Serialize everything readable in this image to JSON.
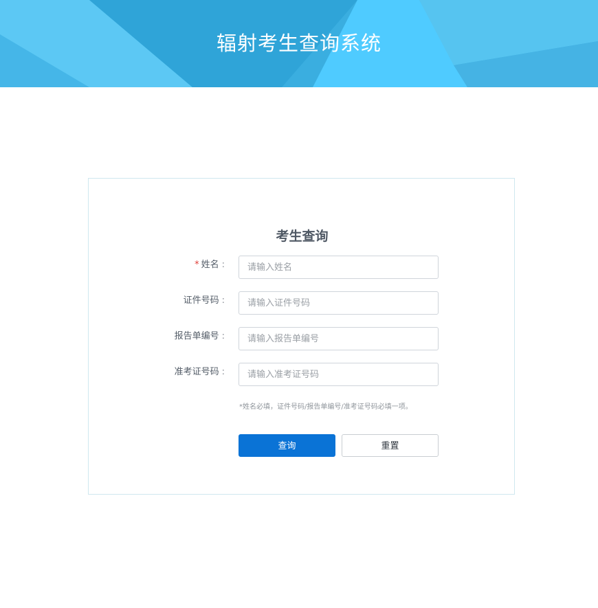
{
  "header": {
    "title": "辐射考生查询系统"
  },
  "form": {
    "title": "考生查询",
    "required_mark": "*",
    "colon": ":",
    "fields": [
      {
        "label": "姓名",
        "placeholder": "请输入姓名",
        "value": "",
        "required": true
      },
      {
        "label": "证件号码",
        "placeholder": "请输入证件号码",
        "value": "",
        "required": false
      },
      {
        "label": "报告单编号",
        "placeholder": "请输入报告单编号",
        "value": "",
        "required": false
      },
      {
        "label": "准考证号码",
        "placeholder": "请输入准考证号码",
        "value": "",
        "required": false
      }
    ],
    "hint": "*姓名必填，证件号码/报告单编号/准考证号码必填一项。",
    "submit_label": "查询",
    "reset_label": "重置"
  },
  "colors": {
    "banner": "#3aaee0",
    "primary": "#0a73d6",
    "required": "#e0403a"
  }
}
